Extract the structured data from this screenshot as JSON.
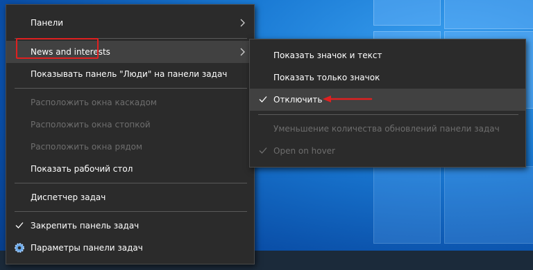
{
  "main_menu": {
    "panels": "Панели",
    "news": "News and interests",
    "people": "Показывать панель \"Люди\" на панели задач",
    "cascade": "Расположить окна каскадом",
    "stack": "Расположить окна стопкой",
    "side": "Расположить окна рядом",
    "desktop": "Показать рабочий стол",
    "task_manager": "Диспетчер задач",
    "lock_taskbar": "Закрепить панель задач",
    "taskbar_settings": "Параметры панели задач"
  },
  "sub_menu": {
    "show_icon_text": "Показать значок и текст",
    "show_icon_only": "Показать только значок",
    "turn_off": "Отключить",
    "reduce_updates": "Уменьшение количества обновлений панели задач",
    "open_on_hover": "Open on hover"
  },
  "icons": {
    "check": "check-icon",
    "chevron": "chevron-right-icon",
    "gear": "gear-icon"
  },
  "colors": {
    "menu_bg": "#2b2b2b",
    "highlight": "#e02020"
  }
}
